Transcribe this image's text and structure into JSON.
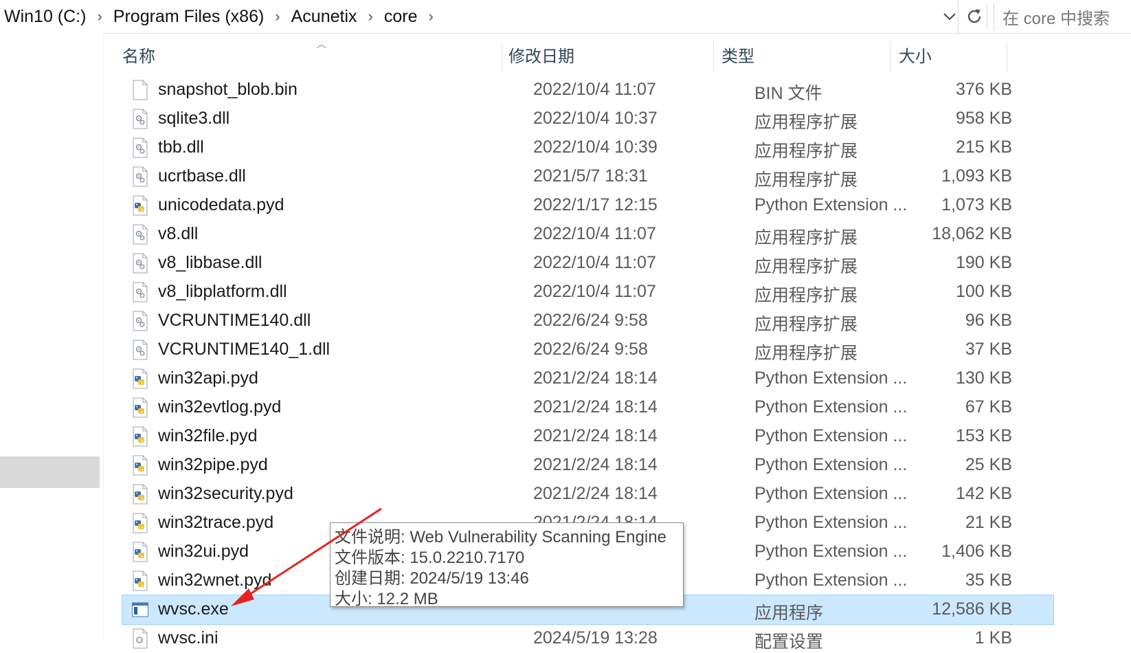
{
  "address_bar": {
    "crumbs": [
      "Win10 (C:)",
      "Program Files (x86)",
      "Acunetix",
      "core"
    ],
    "separator": "›",
    "search_placeholder": "在 core 中搜索"
  },
  "columns": {
    "name": "名称",
    "date": "修改日期",
    "type": "类型",
    "size": "大小"
  },
  "files": [
    {
      "name": "snapshot_blob.bin",
      "date": "2022/10/4 11:07",
      "type": "BIN 文件",
      "size": "376 KB",
      "icon": "blank-file-icon"
    },
    {
      "name": "sqlite3.dll",
      "date": "2022/10/4 10:37",
      "type": "应用程序扩展",
      "size": "958 KB",
      "icon": "dll-file-icon"
    },
    {
      "name": "tbb.dll",
      "date": "2022/10/4 10:39",
      "type": "应用程序扩展",
      "size": "215 KB",
      "icon": "dll-file-icon"
    },
    {
      "name": "ucrtbase.dll",
      "date": "2021/5/7 18:31",
      "type": "应用程序扩展",
      "size": "1,093 KB",
      "icon": "dll-file-icon"
    },
    {
      "name": "unicodedata.pyd",
      "date": "2022/1/17 12:15",
      "type": "Python Extension ...",
      "size": "1,073 KB",
      "icon": "python-file-icon"
    },
    {
      "name": "v8.dll",
      "date": "2022/10/4 11:07",
      "type": "应用程序扩展",
      "size": "18,062 KB",
      "icon": "dll-file-icon"
    },
    {
      "name": "v8_libbase.dll",
      "date": "2022/10/4 11:07",
      "type": "应用程序扩展",
      "size": "190 KB",
      "icon": "dll-file-icon"
    },
    {
      "name": "v8_libplatform.dll",
      "date": "2022/10/4 11:07",
      "type": "应用程序扩展",
      "size": "100 KB",
      "icon": "dll-file-icon"
    },
    {
      "name": "VCRUNTIME140.dll",
      "date": "2022/6/24 9:58",
      "type": "应用程序扩展",
      "size": "96 KB",
      "icon": "dll-file-icon"
    },
    {
      "name": "VCRUNTIME140_1.dll",
      "date": "2022/6/24 9:58",
      "type": "应用程序扩展",
      "size": "37 KB",
      "icon": "dll-file-icon"
    },
    {
      "name": "win32api.pyd",
      "date": "2021/2/24 18:14",
      "type": "Python Extension ...",
      "size": "130 KB",
      "icon": "python-file-icon"
    },
    {
      "name": "win32evtlog.pyd",
      "date": "2021/2/24 18:14",
      "type": "Python Extension ...",
      "size": "67 KB",
      "icon": "python-file-icon"
    },
    {
      "name": "win32file.pyd",
      "date": "2021/2/24 18:14",
      "type": "Python Extension ...",
      "size": "153 KB",
      "icon": "python-file-icon"
    },
    {
      "name": "win32pipe.pyd",
      "date": "2021/2/24 18:14",
      "type": "Python Extension ...",
      "size": "25 KB",
      "icon": "python-file-icon"
    },
    {
      "name": "win32security.pyd",
      "date": "2021/2/24 18:14",
      "type": "Python Extension ...",
      "size": "142 KB",
      "icon": "python-file-icon"
    },
    {
      "name": "win32trace.pyd",
      "date": "2021/2/24 18:14",
      "type": "Python Extension ...",
      "size": "21 KB",
      "icon": "python-file-icon"
    },
    {
      "name": "win32ui.pyd",
      "date": "",
      "type": "Python Extension ...",
      "size": "1,406 KB",
      "icon": "python-file-icon"
    },
    {
      "name": "win32wnet.pyd",
      "date": "",
      "type": "Python Extension ...",
      "size": "35 KB",
      "icon": "python-file-icon"
    },
    {
      "name": "wvsc.exe",
      "date": "",
      "type": "应用程序",
      "size": "12,586 KB",
      "icon": "exe-file-icon",
      "selected": true
    },
    {
      "name": "wvsc.ini",
      "date": "2024/5/19 13:28",
      "type": "配置设置",
      "size": "1 KB",
      "icon": "ini-file-icon"
    }
  ],
  "tooltip": {
    "lines": [
      "文件说明: Web Vulnerability Scanning Engine",
      "文件版本: 15.0.2210.7170",
      "创建日期: 2024/5/19 13:46",
      "大小: 12.2 MB"
    ]
  },
  "colors": {
    "selected_row": "#cce8ff",
    "header_text": "#33465c",
    "annotation_arrow": "#e8231f"
  }
}
